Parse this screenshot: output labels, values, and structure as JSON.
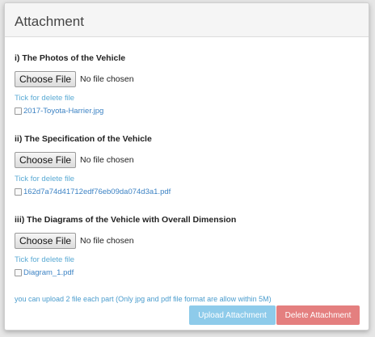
{
  "panel": {
    "title": "Attachment"
  },
  "sections": [
    {
      "title": "i) The Photos of the Vehicle",
      "choose_label": "Choose File",
      "status": "No file chosen",
      "tick_label": "Tick for delete file",
      "file_name": "2017-Toyota-Harrier.jpg"
    },
    {
      "title": "ii) The Specification of the Vehicle",
      "choose_label": "Choose File",
      "status": "No file chosen",
      "tick_label": "Tick for delete file",
      "file_name": "162d7a74d41712edf76eb09da074d3a1.pdf"
    },
    {
      "title": "iii) The Diagrams of the Vehicle with Overall Dimension",
      "choose_label": "Choose File",
      "status": "No file chosen",
      "tick_label": "Tick for delete file",
      "file_name": "Diagram_1.pdf"
    }
  ],
  "note": "you can upload 2 file each part (Only jpg and pdf file format are allow within 5M)",
  "actions": {
    "upload_label": "Upload Attachment",
    "delete_label": "Delete Attachment"
  },
  "colors": {
    "upload_button": "#8ecbea",
    "delete_button": "#e47f7f",
    "link": "#3d83c4",
    "tick_label": "#5aaad4"
  }
}
